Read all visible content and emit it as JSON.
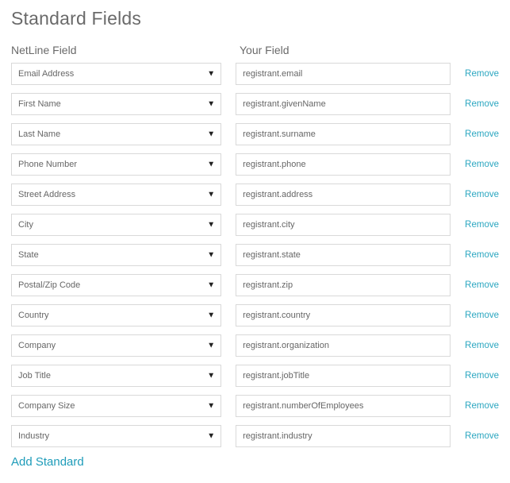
{
  "title": "Standard Fields",
  "headers": {
    "netline": "NetLine Field",
    "your": "Your Field"
  },
  "removeLabel": "Remove",
  "addLabel": "Add Standard",
  "rows": [
    {
      "netline": "Email Address",
      "your": "registrant.email"
    },
    {
      "netline": "First Name",
      "your": "registrant.givenName"
    },
    {
      "netline": "Last Name",
      "your": "registrant.surname"
    },
    {
      "netline": "Phone Number",
      "your": "registrant.phone"
    },
    {
      "netline": "Street Address",
      "your": "registrant.address"
    },
    {
      "netline": "City",
      "your": "registrant.city"
    },
    {
      "netline": "State",
      "your": "registrant.state"
    },
    {
      "netline": "Postal/Zip Code",
      "your": "registrant.zip"
    },
    {
      "netline": "Country",
      "your": "registrant.country"
    },
    {
      "netline": "Company",
      "your": "registrant.organization"
    },
    {
      "netline": "Job Title",
      "your": "registrant.jobTitle"
    },
    {
      "netline": "Company Size",
      "your": "registrant.numberOfEmployees"
    },
    {
      "netline": "Industry",
      "your": "registrant.industry"
    }
  ]
}
